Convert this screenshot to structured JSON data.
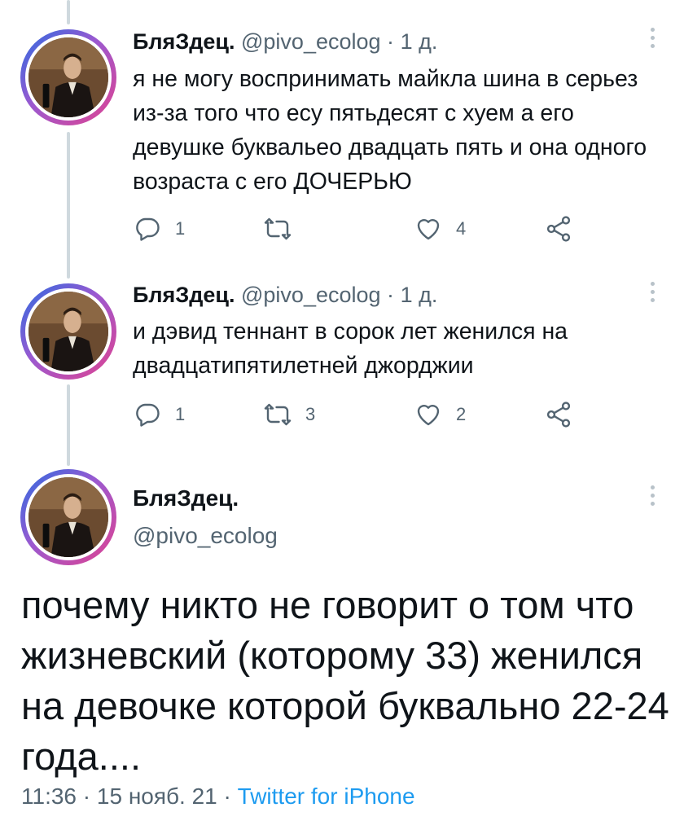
{
  "colors": {
    "accent": "#1d9bf0",
    "muted": "#536471",
    "text": "#0f1419",
    "thread_line": "#cfd9de"
  },
  "tweets": [
    {
      "name": "БляЗдец.",
      "handle": "@pivo_ecolog",
      "separator": "·",
      "time": "1 д.",
      "text": "я не могу воспринимать майкла шина в серьез из-за того что есу пятьдесят с хуем а его девушке буквальео двадцать пять и она одного возраста с его ДОЧЕРЬЮ",
      "replies": "1",
      "retweets": "",
      "likes": "4"
    },
    {
      "name": "БляЗдец.",
      "handle": "@pivo_ecolog",
      "separator": "·",
      "time": "1 д.",
      "text": "и дэвид теннант в сорок лет женился на двадцатипятилетней джорджии",
      "replies": "1",
      "retweets": "3",
      "likes": "2"
    }
  ],
  "main_tweet": {
    "name": "БляЗдец.",
    "handle": "@pivo_ecolog",
    "text": "почему никто не говорит о том что жизневский (которому 33) женился на девочке которой буквально 22-24 года....",
    "time": "11:36",
    "separator": "·",
    "date": "15 нояб. 21",
    "source": "Twitter for iPhone"
  },
  "icons": [
    "reply-icon",
    "retweet-icon",
    "like-icon",
    "share-icon",
    "more-icon",
    "avatar"
  ]
}
